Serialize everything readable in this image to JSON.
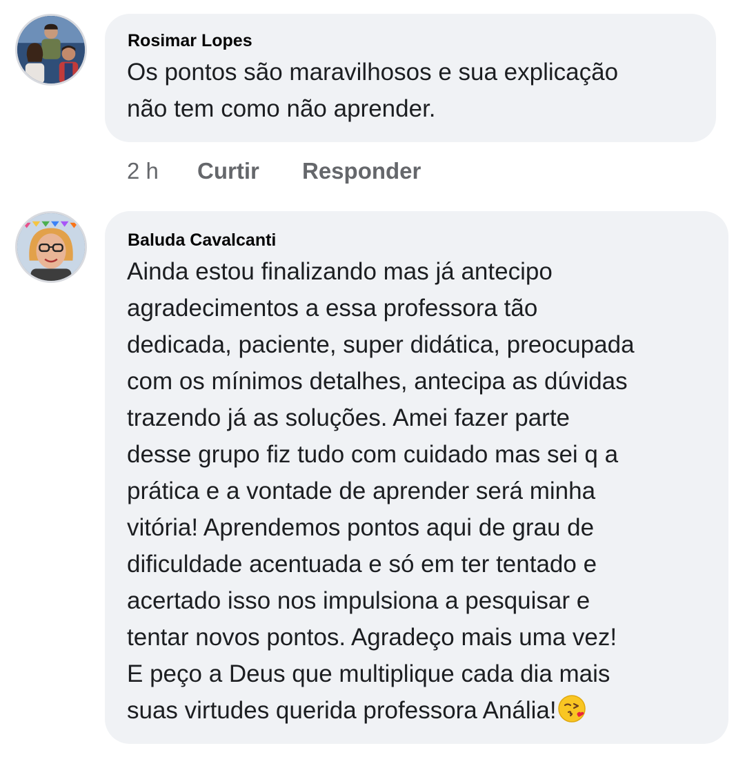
{
  "comments": [
    {
      "author": "Rosimar Lopes",
      "lines": [
        "Os pontos são maravilhosos e sua explicação",
        "não tem como não aprender."
      ],
      "time": "2 h",
      "like_label": "Curtir",
      "reply_label": "Responder"
    },
    {
      "author": "Baluda Cavalcanti",
      "lines": [
        "Ainda estou finalizando mas já antecipo",
        "agradecimentos a essa professora tão",
        "dedicada, paciente, super didática, preocupada",
        "com os mínimos detalhes, antecipa as dúvidas",
        "trazendo já as soluções. Amei fazer parte",
        "desse grupo fiz tudo com cuidado mas sei q a",
        "prática e a vontade de aprender será minha",
        "vitória!  Aprendemos pontos aqui de grau de",
        "dificuldade acentuada e só em ter tentado e",
        "acertado isso nos impulsiona a pesquisar e",
        "tentar novos pontos. Agradeço mais uma vez!",
        "E peço a Deus que multiplique cada dia mais",
        "suas virtudes querida professora Anália!"
      ],
      "emoji": "face-blowing-kiss-emoji"
    }
  ],
  "colors": {
    "bubble_bg": "#f0f2f5",
    "meta_text": "#65676b",
    "body_text": "#1c1e21"
  }
}
